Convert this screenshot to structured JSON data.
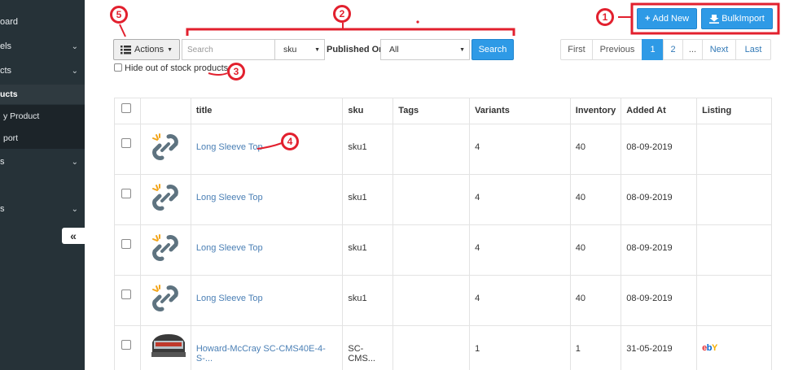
{
  "sidebar": {
    "items": [
      {
        "label": "oard",
        "chevron": false
      },
      {
        "label": "els",
        "chevron": true
      },
      {
        "label": "cts",
        "chevron": true
      },
      {
        "label": "ucts",
        "active": true
      },
      {
        "label": "y Product",
        "sub": true
      },
      {
        "label": "port",
        "sub": true
      },
      {
        "label": "s",
        "chevron": true
      },
      {
        "label": "s",
        "chevron": true
      }
    ],
    "collapse_icon": "«"
  },
  "toolbar": {
    "actions_label": "Actions",
    "search_placeholder": "Search",
    "sku_select": "sku",
    "published_on_label": "Published On",
    "published_select": "All",
    "search_button": "Search",
    "add_new_label": "Add New",
    "bulk_import_label": "BulkImport",
    "hide_out_of_stock_label": "Hide out of stock products"
  },
  "pagination": {
    "first": "First",
    "previous": "Previous",
    "pages": [
      "1",
      "2",
      "..."
    ],
    "current": "1",
    "next": "Next",
    "last": "Last"
  },
  "table": {
    "headers": [
      "title",
      "sku",
      "Tags",
      "Variants",
      "Inventory",
      "Added At",
      "Listing"
    ],
    "rows": [
      {
        "title": "Long Sleeve Top",
        "sku": "sku1",
        "tags": "",
        "variants": "4",
        "inventory": "40",
        "added_at": "08-09-2019",
        "listing": "",
        "thumb": "placeholder"
      },
      {
        "title": "Long Sleeve Top",
        "sku": "sku1",
        "tags": "",
        "variants": "4",
        "inventory": "40",
        "added_at": "08-09-2019",
        "listing": "",
        "thumb": "placeholder"
      },
      {
        "title": "Long Sleeve Top",
        "sku": "sku1",
        "tags": "",
        "variants": "4",
        "inventory": "40",
        "added_at": "08-09-2019",
        "listing": "",
        "thumb": "placeholder"
      },
      {
        "title": "Long Sleeve Top",
        "sku": "sku1",
        "tags": "",
        "variants": "4",
        "inventory": "40",
        "added_at": "08-09-2019",
        "listing": "",
        "thumb": "placeholder"
      },
      {
        "title": "Howard-McCray SC-CMS40E-4-S-...",
        "sku": "SC-CMS...",
        "tags": "",
        "variants": "1",
        "inventory": "1",
        "added_at": "31-05-2019",
        "listing": "ebY",
        "thumb": "display-case"
      }
    ]
  },
  "annotations": {
    "badges": [
      "1",
      "2",
      "3",
      "4",
      "5"
    ],
    "color": "#e2202e"
  },
  "colors": {
    "primary": "#2e9ae6",
    "sidebar": "#263238",
    "link": "#4a7fb5",
    "annotation": "#e2202e"
  }
}
